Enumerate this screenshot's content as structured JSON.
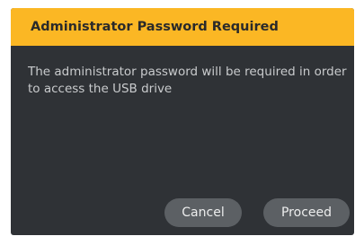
{
  "dialog": {
    "title": "Administrator Password Required",
    "message": "The administrator password will be required in order to access the USB drive",
    "cancel_label": "Cancel",
    "proceed_label": "Proceed"
  },
  "colors": {
    "header": "#fbb724",
    "background": "#2f3236",
    "button": "#5c6064"
  }
}
